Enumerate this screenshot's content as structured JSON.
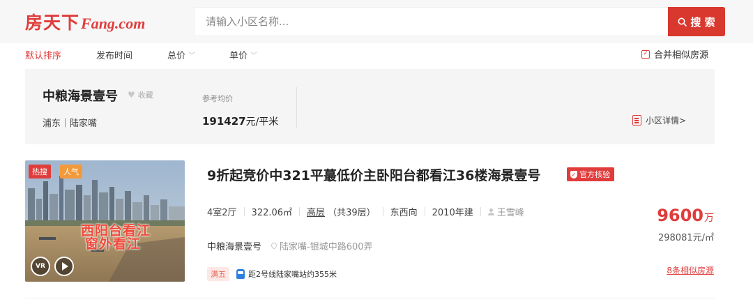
{
  "header": {
    "logo_cn": "房天下",
    "logo_en": "Fang.com",
    "search_placeholder": "请输入小区名称...",
    "search_button": "搜 索"
  },
  "sort_bar": {
    "items": [
      {
        "label": "默认排序",
        "active": true
      },
      {
        "label": "发布时间",
        "active": false
      },
      {
        "label": "总价",
        "active": false
      },
      {
        "label": "单价",
        "active": false
      }
    ],
    "merge_label": "合并相似房源",
    "merge_checked": true
  },
  "community": {
    "name": "中粮海景壹号",
    "favorite_label": "收藏",
    "location": "浦东｜陆家嘴",
    "ref_price_label": "参考均价",
    "ref_price_value": "191427",
    "ref_price_unit": "元/平米",
    "detail_link": "小区详情>"
  },
  "listing": {
    "tag_hot": "热搜",
    "tag_popular": "人气",
    "image_overlay_line1": "西阳台看江",
    "image_overlay_line2": "窗外看江",
    "vr_label": "VR",
    "title": "9折起竞价中321平蕞低价主卧阳台都看江36楼海景壹号",
    "verified_label": "官方核验",
    "layout": "4室2厅",
    "area": "322.06㎡",
    "floor": "高层",
    "floor_total": "（共39层）",
    "orientation": "东西向",
    "year_built": "2010年建",
    "agent": "王雪峰",
    "community_name": "中粮海景壹号",
    "address": "陆家嘴-银城中路600弄",
    "tag_man5": "满五",
    "metro_info": "距2号线陆家嘴站约355米",
    "total_price": "9600",
    "total_price_unit": "万",
    "unit_price": "298081元/㎡",
    "similar_link": "8条相似房源"
  },
  "colors": {
    "brand_red": "#e03c3c",
    "search_button": "#d9382e",
    "tag_orange": "#f29a3b",
    "metro_blue": "#2f7fe0"
  }
}
